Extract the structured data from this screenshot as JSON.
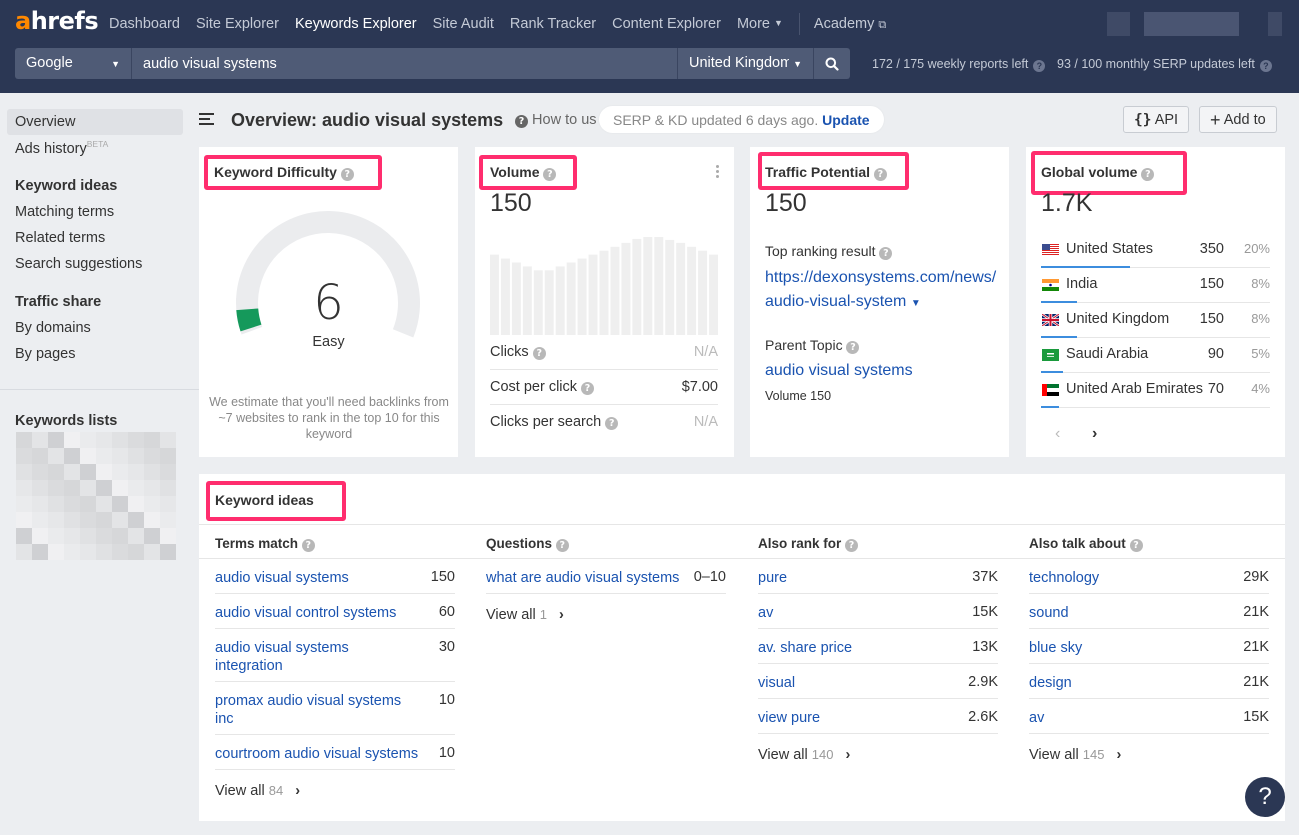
{
  "topbar": {
    "logo_accent": "a",
    "logo_rest": "hrefs",
    "nav": [
      {
        "label": "Dashboard",
        "active": false
      },
      {
        "label": "Site Explorer",
        "active": false
      },
      {
        "label": "Keywords Explorer",
        "active": true
      },
      {
        "label": "Site Audit",
        "active": false
      },
      {
        "label": "Rank Tracker",
        "active": false
      },
      {
        "label": "Content Explorer",
        "active": false
      }
    ],
    "more_label": "More",
    "academy_label": "Academy",
    "search_engine": "Google",
    "keyword_value": "audio visual systems",
    "country": "United Kingdom",
    "weekly_reports": "172 / 175 weekly reports left",
    "monthly_serp": "93 / 100 monthly SERP updates left"
  },
  "sidebar": {
    "overview": "Overview",
    "ads_history": "Ads history",
    "beta": "BETA",
    "keyword_ideas_head": "Keyword ideas",
    "matching_terms": "Matching terms",
    "related_terms": "Related terms",
    "search_suggestions": "Search suggestions",
    "traffic_share_head": "Traffic share",
    "by_domains": "By domains",
    "by_pages": "By pages",
    "keywords_lists_head": "Keywords lists"
  },
  "header": {
    "title": "Overview: audio visual systems",
    "howto": "How to us",
    "update_text": "SERP & KD updated 6 days ago.",
    "update_link": "Update",
    "api_label": "API",
    "add_to_label": "Add to"
  },
  "kd_card": {
    "title": "Keyword Difficulty",
    "value": "6",
    "score": 6,
    "label": "Easy",
    "description": "We estimate that you'll need backlinks from ~7 websites to rank in the top 10 for this keyword",
    "color": "#15995b"
  },
  "volume_card": {
    "title": "Volume",
    "value": "150",
    "trend_relative": [
      0.82,
      0.78,
      0.74,
      0.7,
      0.66,
      0.66,
      0.7,
      0.74,
      0.78,
      0.82,
      0.86,
      0.9,
      0.94,
      0.98,
      1.0,
      1.0,
      0.97,
      0.94,
      0.9,
      0.86,
      0.82
    ],
    "metrics": [
      {
        "label": "Clicks",
        "value": "N/A"
      },
      {
        "label": "Cost per click",
        "value": "$7.00"
      },
      {
        "label": "Clicks per search",
        "value": "N/A"
      }
    ]
  },
  "traffic_card": {
    "title": "Traffic Potential",
    "value": "150",
    "top_ranking_label": "Top ranking result",
    "top_ranking_url": "https://dexonsystems.com/news/audio-visual-system",
    "parent_topic_label": "Parent Topic",
    "parent_topic": "audio visual systems",
    "parent_volume": "Volume 150"
  },
  "global_card": {
    "title": "Global volume",
    "value": "1.7K",
    "countries": [
      {
        "name": "United States",
        "volume": "350",
        "pct": "20%",
        "share": 0.2,
        "flag": "us"
      },
      {
        "name": "India",
        "volume": "150",
        "pct": "8%",
        "share": 0.08,
        "flag": "in"
      },
      {
        "name": "United Kingdom",
        "volume": "150",
        "pct": "8%",
        "share": 0.08,
        "flag": "gb"
      },
      {
        "name": "Saudi Arabia",
        "volume": "90",
        "pct": "5%",
        "share": 0.05,
        "flag": "sa"
      },
      {
        "name": "United Arab Emirates",
        "volume": "70",
        "pct": "4%",
        "share": 0.04,
        "flag": "ae"
      }
    ]
  },
  "ideas": {
    "title": "Keyword ideas",
    "view_all": "View all",
    "columns": [
      {
        "head": "Terms match",
        "count": "84",
        "rows": [
          {
            "kw": "audio visual systems",
            "num": "150",
            "lines": 1
          },
          {
            "kw": "audio visual control systems",
            "num": "60",
            "lines": 1
          },
          {
            "kw": "audio visual systems integration",
            "num": "30",
            "lines": 2
          },
          {
            "kw": "promax audio visual systems inc",
            "num": "10",
            "lines": 2
          },
          {
            "kw": "courtroom audio visual systems",
            "num": "10",
            "lines": 1
          }
        ]
      },
      {
        "head": "Questions",
        "count": "1",
        "rows": [
          {
            "kw": "what are audio visual systems",
            "num": "0–10",
            "lines": 1
          }
        ]
      },
      {
        "head": "Also rank for",
        "count": "140",
        "rows": [
          {
            "kw": "pure",
            "num": "37K",
            "lines": 1
          },
          {
            "kw": "av",
            "num": "15K",
            "lines": 1
          },
          {
            "kw": "av. share price",
            "num": "13K",
            "lines": 1
          },
          {
            "kw": "visual",
            "num": "2.9K",
            "lines": 1
          },
          {
            "kw": "view pure",
            "num": "2.6K",
            "lines": 1
          }
        ]
      },
      {
        "head": "Also talk about",
        "count": "145",
        "rows": [
          {
            "kw": "technology",
            "num": "29K",
            "lines": 1
          },
          {
            "kw": "sound",
            "num": "21K",
            "lines": 1
          },
          {
            "kw": "blue sky",
            "num": "21K",
            "lines": 1
          },
          {
            "kw": "design",
            "num": "21K",
            "lines": 1
          },
          {
            "kw": "av",
            "num": "15K",
            "lines": 1
          }
        ]
      }
    ]
  },
  "help_label": "?"
}
